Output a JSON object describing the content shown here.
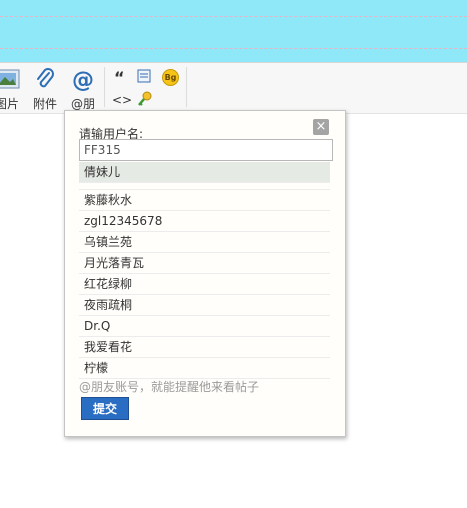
{
  "toolbar": {
    "image_label": "图片",
    "attachment_label": "附件",
    "mention_label": "@朋",
    "icons": {
      "image": "image-icon",
      "attachment": "paperclip-icon",
      "mention": "at-sign-icon",
      "quote": "quote-icon",
      "code": "code-icon",
      "table": "table-icon",
      "hide": "hide-key-icon",
      "bg": "bg-color-icon"
    },
    "quote_glyph": "“",
    "code_glyph": "<>",
    "bg_glyph": "Bg"
  },
  "popup": {
    "close_glyph": "×",
    "prompt": "请输用户名:",
    "input_value": "FF315",
    "suggestions": [
      "倩妹儿",
      "紫藤秋水",
      "zgl12345678",
      "乌镇兰苑",
      "月光落青瓦",
      "红花绿柳",
      "夜雨疏桐",
      "Dr.Q",
      "我爱看花",
      "柠檬"
    ],
    "hint": "@朋友账号，就能提醒他来看帖子",
    "submit_label": "提交"
  },
  "colors": {
    "top_band": "#8ee8f7",
    "submit_bg": "#2a6ec3",
    "selected_row": "#e6eae4",
    "at_icon": "#2d6eb5",
    "bg_icon": "#f5c417"
  }
}
